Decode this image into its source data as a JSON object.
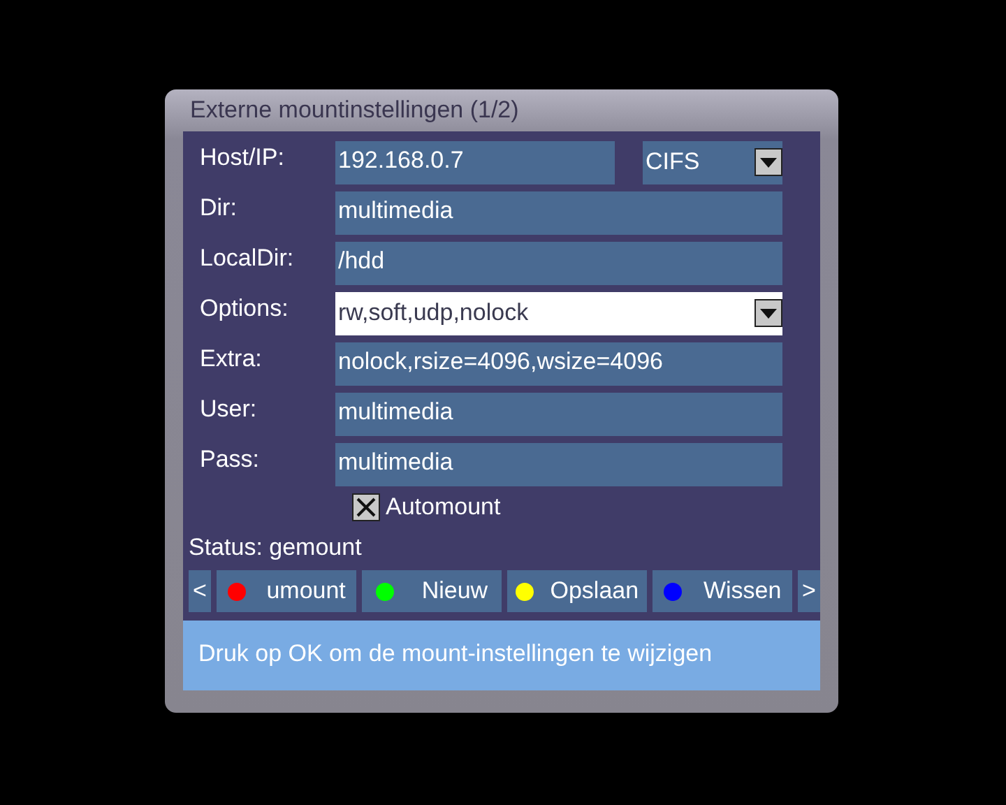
{
  "window": {
    "title": "Externe mountinstellingen (1/2)"
  },
  "fields": [
    {
      "label": "Host/IP:",
      "value": "192.168.0.7",
      "kind": "text",
      "selected": false,
      "protocol": {
        "value": "CIFS",
        "selected": false
      }
    },
    {
      "label": "Dir:",
      "value": "multimedia",
      "kind": "text",
      "selected": false
    },
    {
      "label": "LocalDir:",
      "value": "/hdd",
      "kind": "text",
      "selected": false
    },
    {
      "label": "Options:",
      "value": "rw,soft,udp,nolock",
      "kind": "dropdown",
      "selected": true
    },
    {
      "label": "Extra:",
      "value": "nolock,rsize=4096,wsize=4096",
      "kind": "text",
      "selected": false
    },
    {
      "label": "User:",
      "value": "multimedia",
      "kind": "text",
      "selected": false
    },
    {
      "label": "Pass:",
      "value": "multimedia",
      "kind": "text",
      "selected": false
    }
  ],
  "automount": {
    "label": "Automount",
    "checked": true
  },
  "status": "Status: gemount",
  "buttons": [
    {
      "kind": "nav",
      "label": "<"
    },
    {
      "kind": "color",
      "label": "umount",
      "color": "#ff0000"
    },
    {
      "kind": "color",
      "label": "Nieuw",
      "color": "#00ff00"
    },
    {
      "kind": "color",
      "label": "Opslaan",
      "color": "#ffff00"
    },
    {
      "kind": "color",
      "label": "Wissen",
      "color": "#0000ff"
    },
    {
      "kind": "nav",
      "label": ">"
    }
  ],
  "hint": "Druk op OK om de mount-instellingen te wijzigen"
}
